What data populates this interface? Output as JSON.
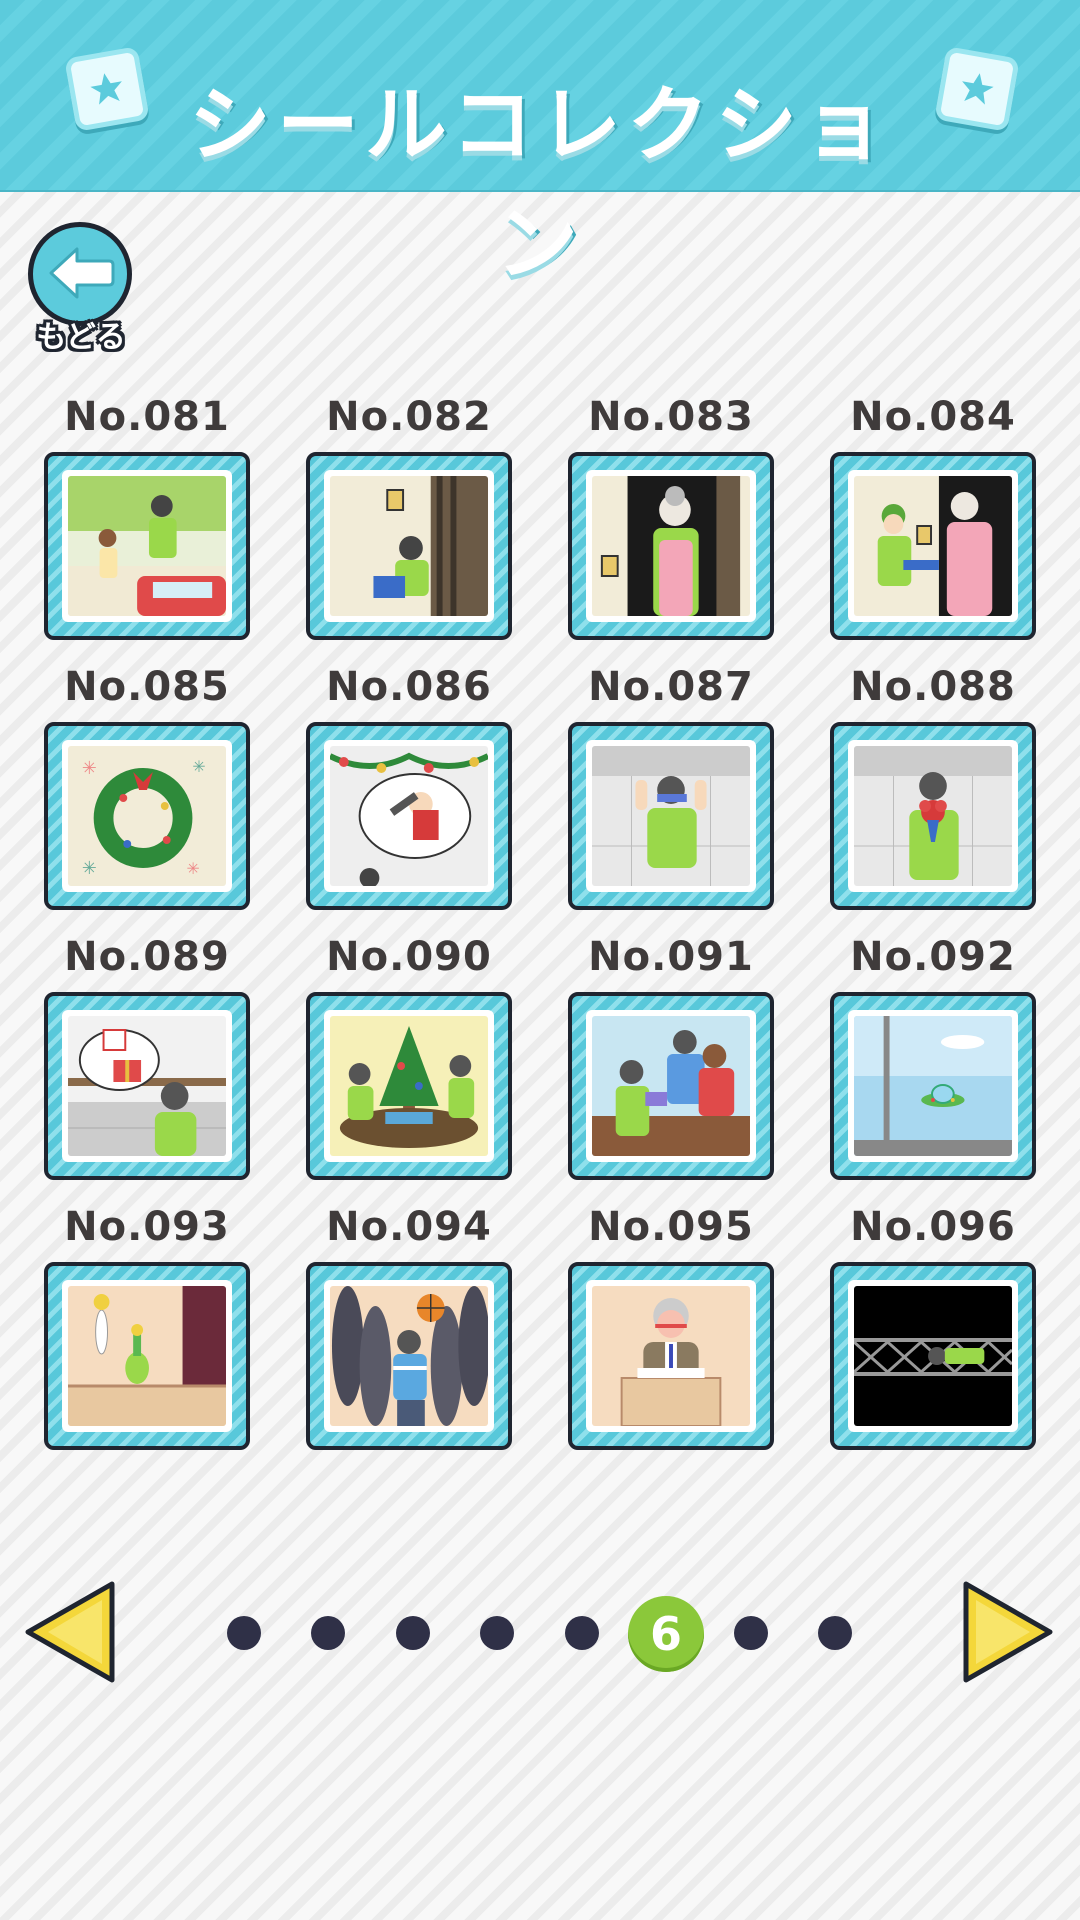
{
  "header": {
    "title": "シールコレクション",
    "left_icon": "star-badge-icon",
    "right_icon": "star-badge-icon"
  },
  "back": {
    "label": "もどる",
    "icon": "arrow-left-icon"
  },
  "stickers": [
    {
      "label": "No.081"
    },
    {
      "label": "No.082"
    },
    {
      "label": "No.083"
    },
    {
      "label": "No.084"
    },
    {
      "label": "No.085"
    },
    {
      "label": "No.086"
    },
    {
      "label": "No.087"
    },
    {
      "label": "No.088"
    },
    {
      "label": "No.089"
    },
    {
      "label": "No.090"
    },
    {
      "label": "No.091"
    },
    {
      "label": "No.092"
    },
    {
      "label": "No.093"
    },
    {
      "label": "No.094"
    },
    {
      "label": "No.095"
    },
    {
      "label": "No.096"
    }
  ],
  "pagination": {
    "current_page": "6",
    "total_pages": 8,
    "prev_icon": "triangle-left-icon",
    "next_icon": "triangle-right-icon"
  },
  "colors": {
    "header": "#5ccbdc",
    "frame": "#5ccbdc",
    "active_page": "#8bc83a",
    "dot": "#2f3047",
    "arrow": "#f4d73a"
  }
}
